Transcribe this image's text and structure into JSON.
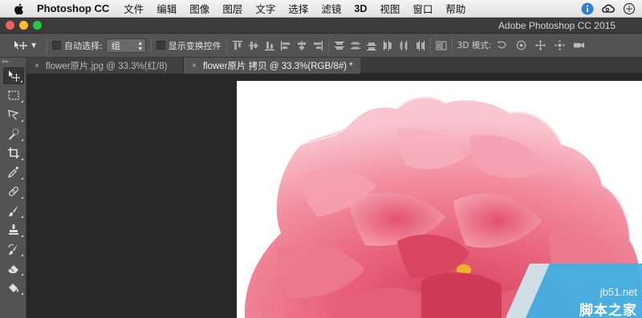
{
  "menubar": {
    "app_name": "Photoshop CC",
    "items": [
      "文件",
      "编辑",
      "图像",
      "图层",
      "文字",
      "选择",
      "滤镜",
      "3D",
      "视图",
      "窗口",
      "帮助"
    ]
  },
  "window": {
    "title": "Adobe Photoshop CC 2015"
  },
  "options": {
    "auto_select_label": "自动选择:",
    "auto_select_value": "组",
    "show_transform_label": "显示变换控件",
    "mode_label": "3D 模式:"
  },
  "tabs": [
    {
      "label": "flower原片.jpg @ 33.3%(红/8)",
      "close": "×"
    },
    {
      "label": "flower原片 拷贝 @ 33.3%(RGB/8#) *",
      "close": "×"
    }
  ],
  "tools": [
    "move-tool-icon",
    "marquee-tool-icon",
    "lasso-tool-icon",
    "quick-selection-tool-icon",
    "crop-tool-icon",
    "eyedropper-tool-icon",
    "healing-brush-tool-icon",
    "brush-tool-icon",
    "clone-stamp-tool-icon",
    "history-brush-tool-icon",
    "eraser-tool-icon",
    "paint-bucket-tool-icon"
  ],
  "toolbar_grip": "▸▸",
  "watermark": {
    "url": "jb51.net",
    "name": "脚本之家"
  },
  "colors": {
    "traffic_close": "#fc5f57",
    "traffic_min": "#fdbc2e",
    "traffic_max": "#28c840",
    "flower_pink": "#ec6f84",
    "watermark_blue": "#3cb3e6"
  }
}
